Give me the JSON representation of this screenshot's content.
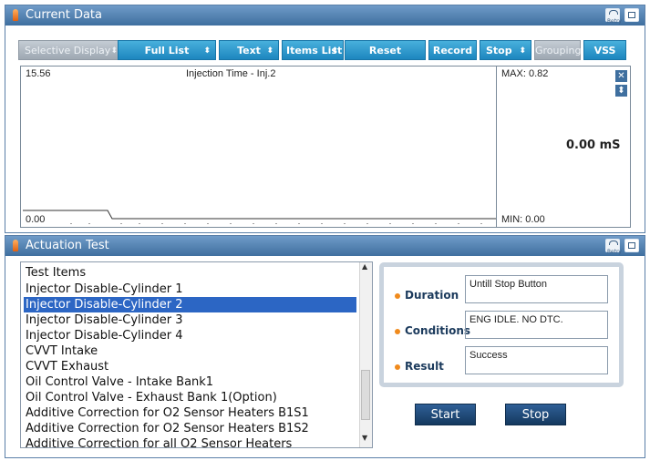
{
  "current_data": {
    "title": "Current Data",
    "toolbar": {
      "selective_display": "Selective Display",
      "full_list": "Full List",
      "text": "Text",
      "items_list": "Items List",
      "reset_min_max": "Reset Min.Max",
      "record": "Record",
      "stop": "Stop",
      "grouping": "Grouping",
      "vss": "VSS"
    },
    "graph": {
      "top_value": "15.56",
      "bottom_value": "0.00",
      "title": "Injection Time - Inj.2",
      "max_label": "MAX: 0.82",
      "min_label": "MIN: 0.00",
      "current_value": "0.00 mS"
    }
  },
  "actuation_test": {
    "title": "Actuation Test",
    "list": {
      "header": "Test Items",
      "items": [
        "Injector Disable-Cylinder 1",
        "Injector Disable-Cylinder 2",
        "Injector Disable-Cylinder 3",
        "Injector Disable-Cylinder 4",
        "CVVT Intake",
        "CVVT Exhaust",
        "Oil Control Valve - Intake Bank1",
        "Oil Control Valve - Exhaust Bank 1(Option)",
        "Additive Correction for O2 Sensor Heaters B1S1",
        "Additive Correction for O2 Sensor Heaters B1S2",
        "Additive Correction for all O2 Sensor Heaters"
      ],
      "selected_index": 1
    },
    "details": {
      "duration_label": "Duration",
      "duration_value": "Untill Stop Button",
      "conditions_label": "Conditions",
      "conditions_value": "ENG IDLE. NO DTC.",
      "result_label": "Result",
      "result_value": "Success"
    },
    "start_label": "Start",
    "stop_label": "Stop"
  },
  "colors": {
    "titlebar": "#3f6f9f",
    "toolbar_button": "#1d86bf",
    "selected_row": "#2c66c4",
    "action_button": "#14395f"
  }
}
